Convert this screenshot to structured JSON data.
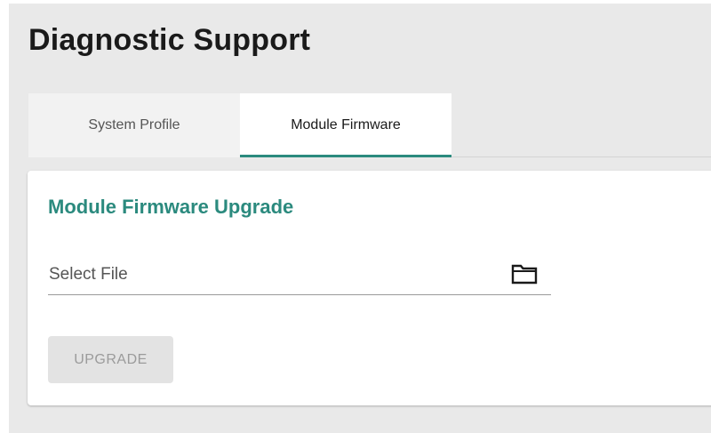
{
  "page": {
    "title": "Diagnostic Support"
  },
  "tabs": [
    {
      "label": "System Profile",
      "active": false
    },
    {
      "label": "Module Firmware",
      "active": true
    }
  ],
  "card": {
    "title": "Module Firmware Upgrade",
    "file_input": {
      "placeholder": "Select File",
      "value": "",
      "icon": "folder-icon"
    },
    "upgrade_button": {
      "label": "UPGRADE",
      "enabled": false
    }
  },
  "colors": {
    "accent": "#2b8a7e",
    "page_background": "#e9e9e9",
    "card_background": "#ffffff",
    "disabled_button_bg": "#e3e3e3",
    "disabled_button_text": "#9b9b9b"
  }
}
